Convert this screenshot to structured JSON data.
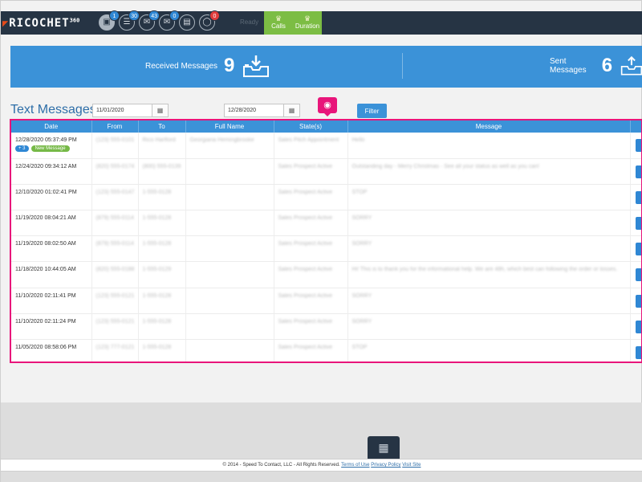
{
  "nav": {
    "brand": "RICOCHET",
    "brand_sup": "360",
    "icons": [
      {
        "name": "document-icon",
        "glyph": "▣",
        "badge": "1",
        "badge_color": "#2f87d4"
      },
      {
        "name": "list-icon",
        "glyph": "☰",
        "badge": "30",
        "badge_color": "#2f87d4"
      },
      {
        "name": "chat-icon",
        "glyph": "✉",
        "badge": "43",
        "badge_color": "#2f87d4"
      },
      {
        "name": "mail-icon",
        "glyph": "✉",
        "badge": "0",
        "badge_color": "#2f87d4"
      },
      {
        "name": "inbox-icon",
        "glyph": "▤",
        "badge": "",
        "badge_color": ""
      },
      {
        "name": "speech-bubble-icon",
        "glyph": "◯",
        "badge": "0",
        "badge_color": "#e03c3c"
      }
    ],
    "status": "Ready",
    "calls_label": "Calls",
    "duration_label": "Duration"
  },
  "stats": {
    "received_label": "Received Messages",
    "received_count": "9",
    "sent_label": "Sent Messages",
    "sent_count": "6"
  },
  "filters": {
    "title": "Text Messages",
    "start_date": "11/01/2020",
    "end_date": "12/28/2020",
    "filter_label": "Filter"
  },
  "table": {
    "columns": [
      "Date",
      "From",
      "To",
      "Full Name",
      "State(s)",
      "Message"
    ],
    "rows": [
      {
        "date": "12/28/2020 05:37:49 PM",
        "from": "(123) 555-0101",
        "to": "Rico Hartford",
        "name": "Georgiana Hemingbrooke",
        "state": "Sales Pitch Appointment",
        "message": "Hello",
        "count_badge": "+ 3",
        "new_badge": "New Message"
      },
      {
        "date": "12/24/2020 09:34:12 AM",
        "from": "(820) 555-0174",
        "to": "(800) 555-0139",
        "name": "",
        "state": "Sales Prospect Active",
        "message": "Outstanding day - Merry Christmas - See all your status as well as you can!",
        "count_badge": "",
        "new_badge": ""
      },
      {
        "date": "12/10/2020 01:02:41 PM",
        "from": "(123) 555-0147",
        "to": "1-555-0128",
        "name": "",
        "state": "Sales Prospect Active",
        "message": "STOP",
        "count_badge": "",
        "new_badge": ""
      },
      {
        "date": "11/19/2020 08:04:21 AM",
        "from": "(879) 555-0114",
        "to": "1-555-0128",
        "name": "",
        "state": "Sales Prospect Active",
        "message": "SORRY",
        "count_badge": "",
        "new_badge": ""
      },
      {
        "date": "11/19/2020 08:02:50 AM",
        "from": "(879) 555-0114",
        "to": "1-555-0128",
        "name": "",
        "state": "Sales Prospect Active",
        "message": "SORRY",
        "count_badge": "",
        "new_badge": ""
      },
      {
        "date": "11/18/2020 10:44:05 AM",
        "from": "(820) 555-0188",
        "to": "1-555-0129",
        "name": "",
        "state": "Sales Prospect Active",
        "message": "Hi! This is to thank you for the informational help. We are 48h, which best can following the order or losses.",
        "count_badge": "",
        "new_badge": ""
      },
      {
        "date": "11/10/2020 02:11:41 PM",
        "from": "(123) 555-0121",
        "to": "1-555-0128",
        "name": "",
        "state": "Sales Prospect Active",
        "message": "SORRY",
        "count_badge": "",
        "new_badge": ""
      },
      {
        "date": "11/10/2020 02:11:24 PM",
        "from": "(123) 555-0121",
        "to": "1-555-0128",
        "name": "",
        "state": "Sales Prospect Active",
        "message": "SORRY",
        "count_badge": "",
        "new_badge": ""
      },
      {
        "date": "11/05/2020 08:58:06 PM",
        "from": "(123) 777-0121",
        "to": "1-555-0128",
        "name": "",
        "state": "Sales Prospect Active",
        "message": "STOP",
        "count_badge": "",
        "new_badge": ""
      }
    ]
  },
  "footer": {
    "copyright": "© 2014 - Speed To Contact, LLC - All Rights Reserved.",
    "terms_label": "Terms of Use",
    "privacy_label": "Privacy Policy",
    "visit_label": "Visit Site"
  },
  "colors": {
    "nav_bg": "#263444",
    "accent_blue": "#3b92d8",
    "green": "#7cbd44",
    "highlight_pink": "#e8157a"
  }
}
